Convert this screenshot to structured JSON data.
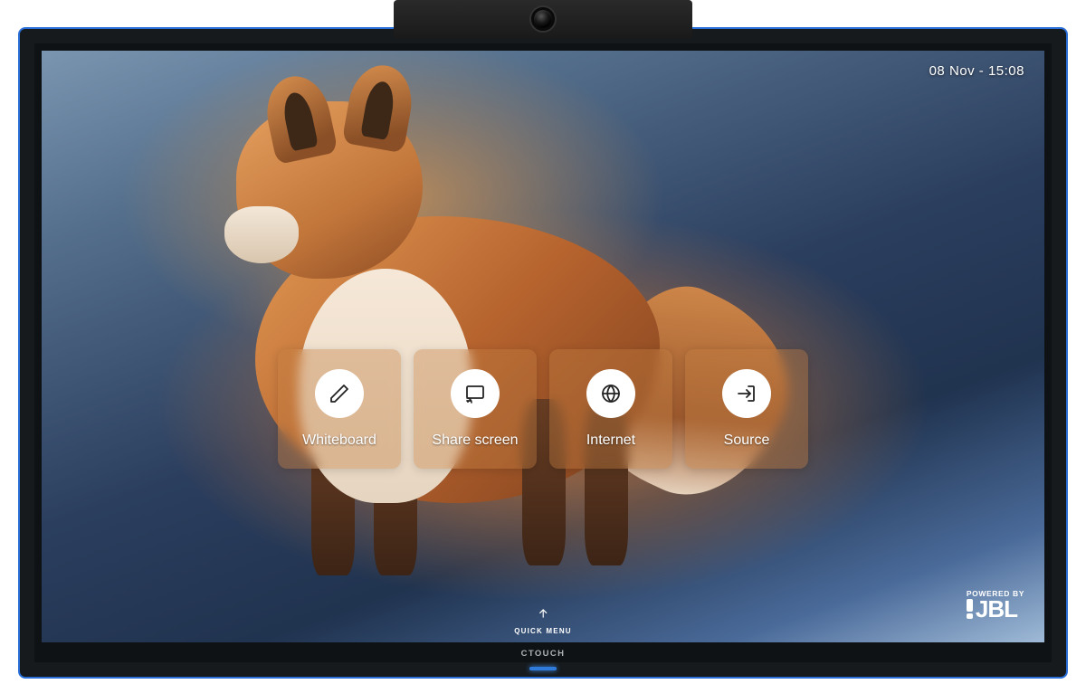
{
  "datetime": "08 Nov - 15:08",
  "tiles": [
    {
      "label": "Whiteboard",
      "icon": "pencil-icon"
    },
    {
      "label": "Share screen",
      "icon": "cast-icon"
    },
    {
      "label": "Internet",
      "icon": "globe-icon"
    },
    {
      "label": "Source",
      "icon": "input-icon"
    }
  ],
  "quick_menu": {
    "label": "QUICK MENU"
  },
  "badge": {
    "powered": "POWERED BY",
    "brand": "JBL"
  },
  "bezel_brand": "CTOUCH"
}
